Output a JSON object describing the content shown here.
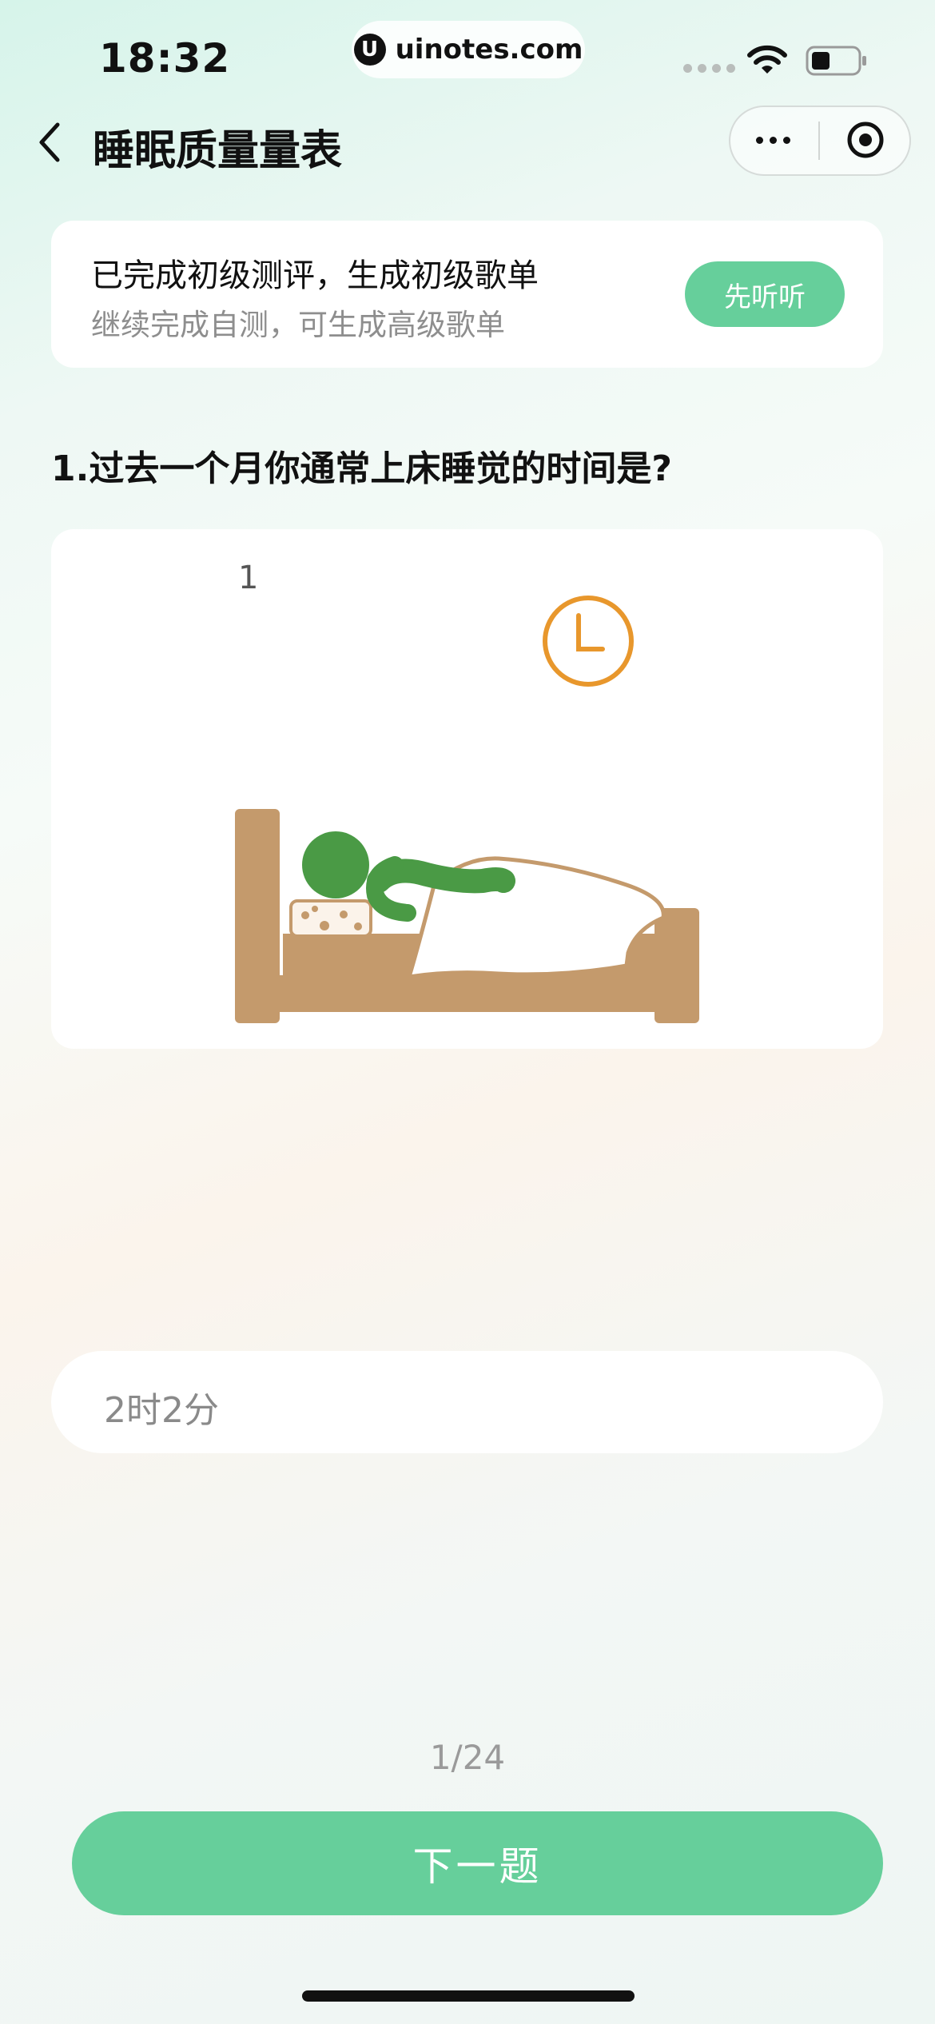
{
  "status_bar": {
    "time": "18:32",
    "url": "uinotes.com",
    "url_logo": "U"
  },
  "nav": {
    "title": "睡眠质量量表",
    "back_icon": "chevron-left-icon",
    "more_icon": "more-dots-icon",
    "close_icon": "target-close-icon"
  },
  "banner": {
    "title": "已完成初级测评，生成初级歌单",
    "subtitle": "继续完成自测，可生成高级歌单",
    "button": "先听听"
  },
  "question": {
    "text": "1.过去一个月你通常上床睡觉的时间是?",
    "image_number": "1"
  },
  "answer": {
    "value": "2时2分"
  },
  "footer": {
    "progress": "1/24",
    "next_button": "下一题"
  },
  "colors": {
    "accent": "#66cf9b",
    "clock": "#e8972c",
    "bed": "#c49a6c",
    "figure": "#4a9a45"
  }
}
